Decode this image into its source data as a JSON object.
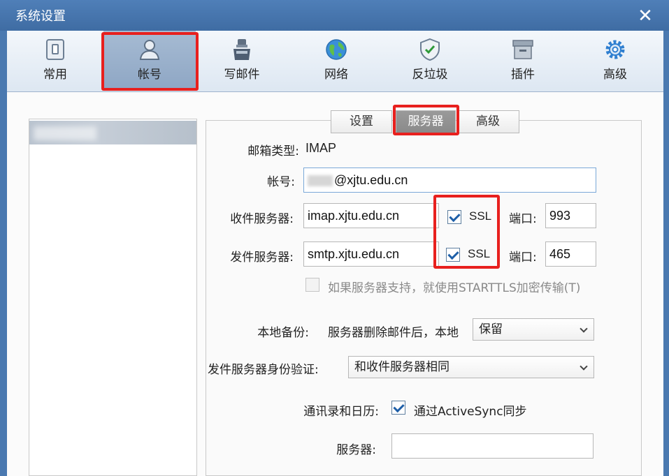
{
  "window": {
    "title": "系统设置",
    "close_glyph": "✕"
  },
  "toolbar": {
    "items": [
      {
        "label": "常用",
        "icon": "general-icon"
      },
      {
        "label": "帐号",
        "icon": "account-icon"
      },
      {
        "label": "写邮件",
        "icon": "compose-icon"
      },
      {
        "label": "网络",
        "icon": "network-globe-icon"
      },
      {
        "label": "反垃圾",
        "icon": "antispam-shield-icon"
      },
      {
        "label": "插件",
        "icon": "plugin-box-icon"
      },
      {
        "label": "高级",
        "icon": "gear-icon"
      }
    ],
    "active_index": 1
  },
  "tabs": [
    {
      "label": "设置"
    },
    {
      "label": "服务器"
    },
    {
      "label": "高级"
    }
  ],
  "server": {
    "mailbox_type_label": "邮箱类型:",
    "mailbox_type_value": "IMAP",
    "account_label": "帐号:",
    "account_value": "@xjtu.edu.cn",
    "incoming_label": "收件服务器:",
    "incoming_value": "imap.xjtu.edu.cn",
    "incoming_ssl_label": "SSL",
    "incoming_port_label": "端口:",
    "incoming_port_value": "993",
    "outgoing_label": "发件服务器:",
    "outgoing_value": "smtp.xjtu.edu.cn",
    "outgoing_ssl_label": "SSL",
    "outgoing_port_label": "端口:",
    "outgoing_port_value": "465",
    "starttls_label": "如果服务器支持，就使用STARTTLS加密传输(T)",
    "backup_label": "本地备份:",
    "backup_desc": "服务器删除邮件后，本地",
    "backup_value": "保留",
    "auth_label": "发件服务器身份验证:",
    "auth_value": "和收件服务器相同",
    "sync_label": "通讯录和日历:",
    "sync_check_label": "通过ActiveSync同步",
    "sync_server_label": "服务器:",
    "sync_server_value": ""
  },
  "colors": {
    "accent": "#4a79b0",
    "highlight": "#e8201e",
    "check": "#1e5fa8"
  }
}
